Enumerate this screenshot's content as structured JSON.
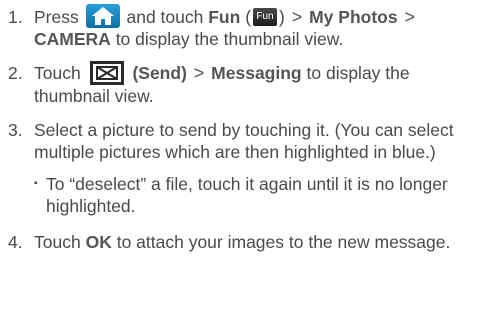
{
  "steps": [
    {
      "num": "1.",
      "part_press": "Press",
      "part_touch": "and touch",
      "fun": "Fun",
      "paren_open": "(",
      "fun_icon_text": "Fun",
      "paren_close": ")",
      "gt": ">",
      "my_photos": "My Photos",
      "camera": "CAMERA",
      "rest": "to display the thumbnail view."
    },
    {
      "num": "2.",
      "part_touch": "Touch",
      "send": "(Send)",
      "gt": ">",
      "messaging": "Messaging",
      "rest": "to display the thumbnail view."
    },
    {
      "num": "3.",
      "text": "Select a picture to send by touching it. (You can select multiple pictures which are then highlighted in blue.)",
      "sub_bullet": "▪",
      "sub_text": "To “deselect” a file, touch it again until it is no longer highlighted."
    },
    {
      "num": "4.",
      "part_touch": "Touch",
      "ok": "OK",
      "rest": "to attach your images to the new message."
    }
  ],
  "icons": {
    "home": "home-icon",
    "fun": "fun-icon",
    "send": "envelope-icon"
  },
  "colors": {
    "body_text": "#4a4a4a",
    "home_blue": "#1a86c2",
    "fun_dark": "#2a2a2a"
  }
}
